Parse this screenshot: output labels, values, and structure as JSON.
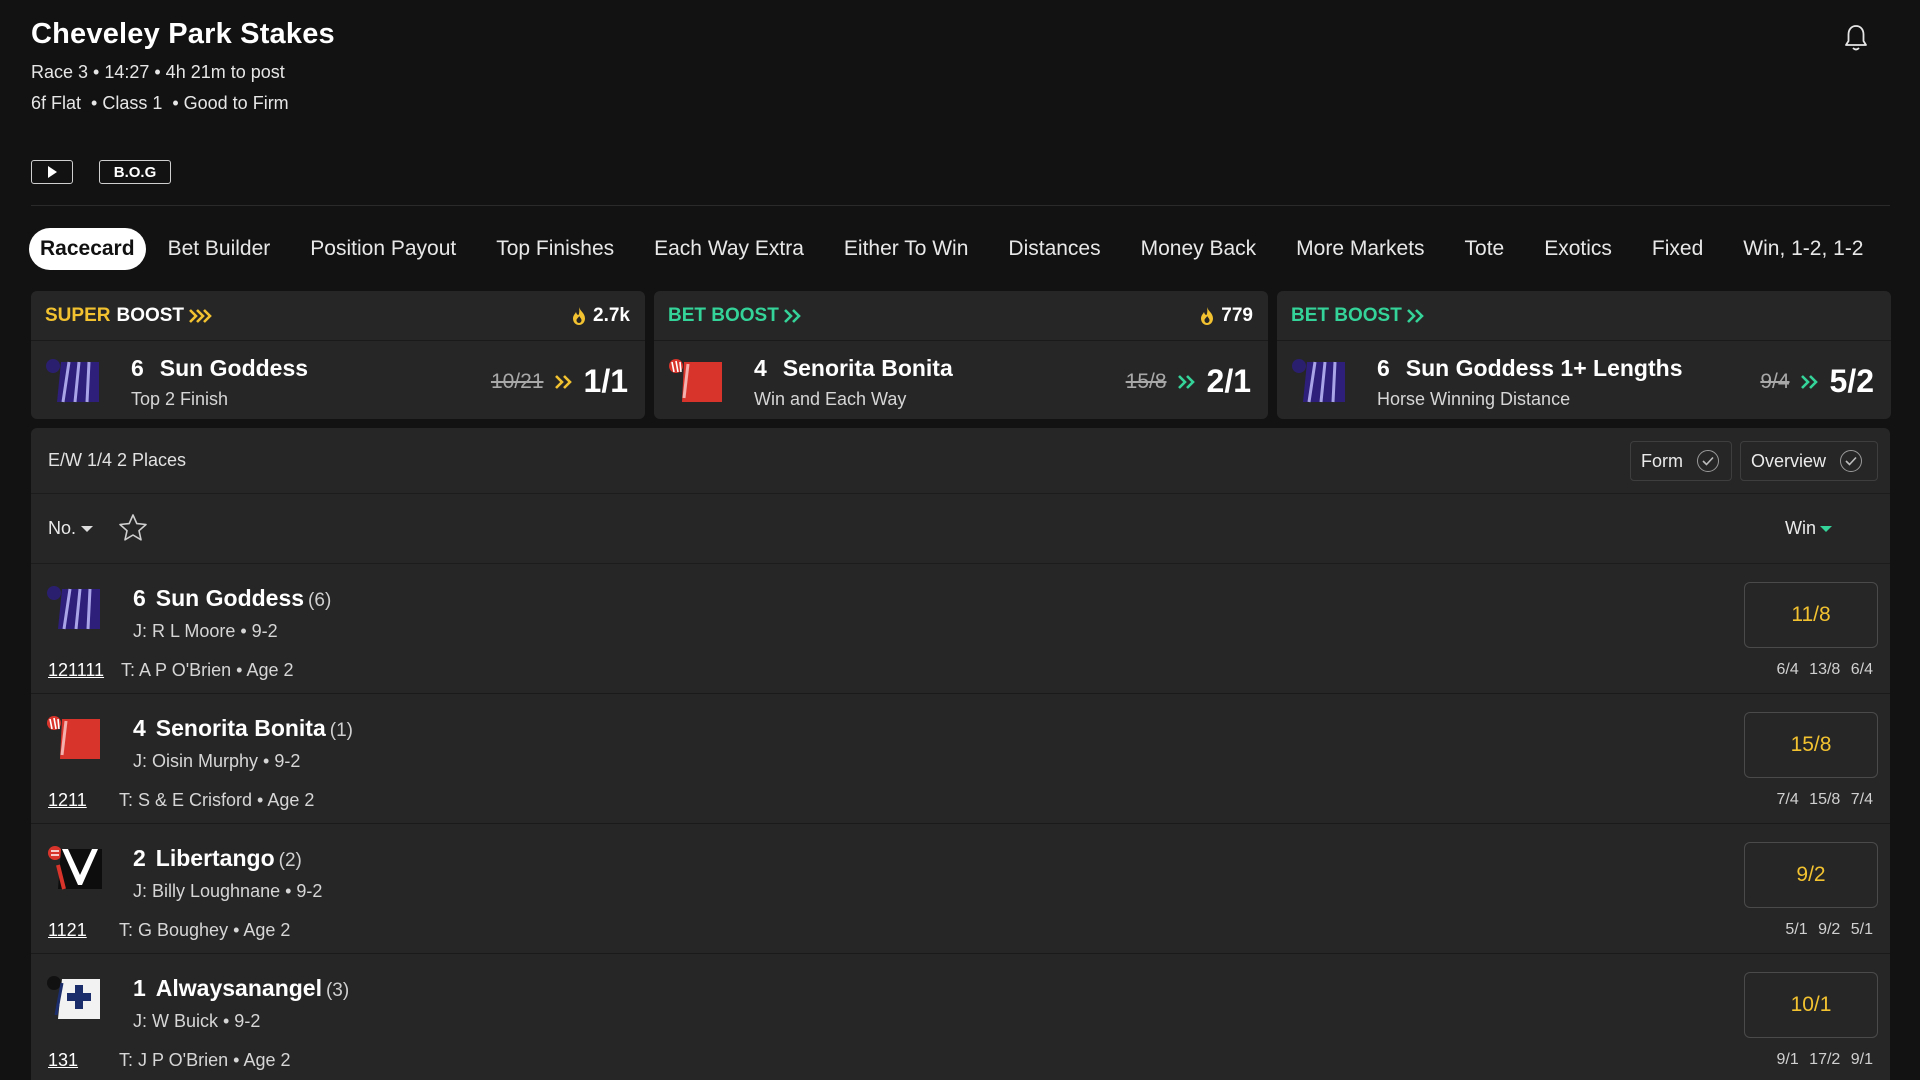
{
  "race": {
    "title": "Cheveley Park Stakes",
    "line1": "Race 3 • 14:27 • 4h 21m to post",
    "line2": "6f Flat  • Class 1  • Good to Firm",
    "bog_label": "B.O.G",
    "play_icon": "play-icon",
    "bell_icon": "bell-icon"
  },
  "tabs": [
    {
      "label": "Racecard",
      "active": true
    },
    {
      "label": "Bet Builder"
    },
    {
      "label": "Position Payout"
    },
    {
      "label": "Top Finishes"
    },
    {
      "label": "Each Way Extra"
    },
    {
      "label": "Either To Win"
    },
    {
      "label": "Distances"
    },
    {
      "label": "Money Back"
    },
    {
      "label": "More Markets"
    },
    {
      "label": "Tote"
    },
    {
      "label": "Exotics"
    },
    {
      "label": "Fixed"
    },
    {
      "label": "Win, 1-2, 1-2"
    }
  ],
  "boosts": [
    {
      "tag_super": "SUPER",
      "tag_boost": "BOOST",
      "count": "2.7k",
      "number": "6",
      "name": "Sun Goddess",
      "sub": "Top 2 Finish",
      "old_odds": "10/21",
      "new_odds": "1/1",
      "silk": "purple-stripes"
    },
    {
      "tag": "BET BOOST",
      "count": "779",
      "number": "4",
      "name": "Senorita Bonita",
      "sub": "Win and Each Way",
      "old_odds": "15/8",
      "new_odds": "2/1",
      "silk": "red"
    },
    {
      "tag": "BET BOOST",
      "number": "6",
      "name": "Sun Goddess 1+ Lengths",
      "sub": "Horse Winning Distance",
      "old_odds": "9/4",
      "new_odds": "5/2",
      "silk": "purple-stripes"
    }
  ],
  "market": {
    "ew_terms": "E/W 1/4 2 Places",
    "form_toggle": "Form",
    "overview_toggle": "Overview",
    "sort_label": "No.",
    "win_label": "Win"
  },
  "runners": [
    {
      "number": "6",
      "name": "Sun Goddess",
      "draw": "(6)",
      "jockey": "J: R L Moore • 9-2",
      "form": "121111",
      "trainer": "T: A P O'Brien • Age 2",
      "odds": "11/8",
      "history": "6/4 13/8 6/4",
      "silk": "purple-stripes"
    },
    {
      "number": "4",
      "name": "Senorita Bonita",
      "draw": "(1)",
      "jockey": "J: Oisin Murphy • 9-2",
      "form": "1211",
      "trainer": "T: S & E Crisford • Age 2",
      "odds": "15/8",
      "history": "7/4 15/8 7/4",
      "silk": "red"
    },
    {
      "number": "2",
      "name": "Libertango",
      "draw": "(2)",
      "jockey": "J: Billy Loughnane • 9-2",
      "form": "1121",
      "trainer": "T: G Boughey • Age 2",
      "odds": "9/2",
      "history": "5/1 9/2 5/1",
      "silk": "black-white-chevron"
    },
    {
      "number": "1",
      "name": "Alwaysanangel",
      "draw": "(3)",
      "jockey": "J: W Buick • 9-2",
      "form": "131",
      "trainer": "T: J P O'Brien • Age 2",
      "odds": "10/1",
      "history": "9/1 17/2 9/1",
      "silk": "white-navy-cross"
    }
  ],
  "colors": {
    "background": "#121212",
    "card": "#262626",
    "super_boost": "#f2c230",
    "bet_boost": "#34d399",
    "odds": "#f2c230"
  }
}
